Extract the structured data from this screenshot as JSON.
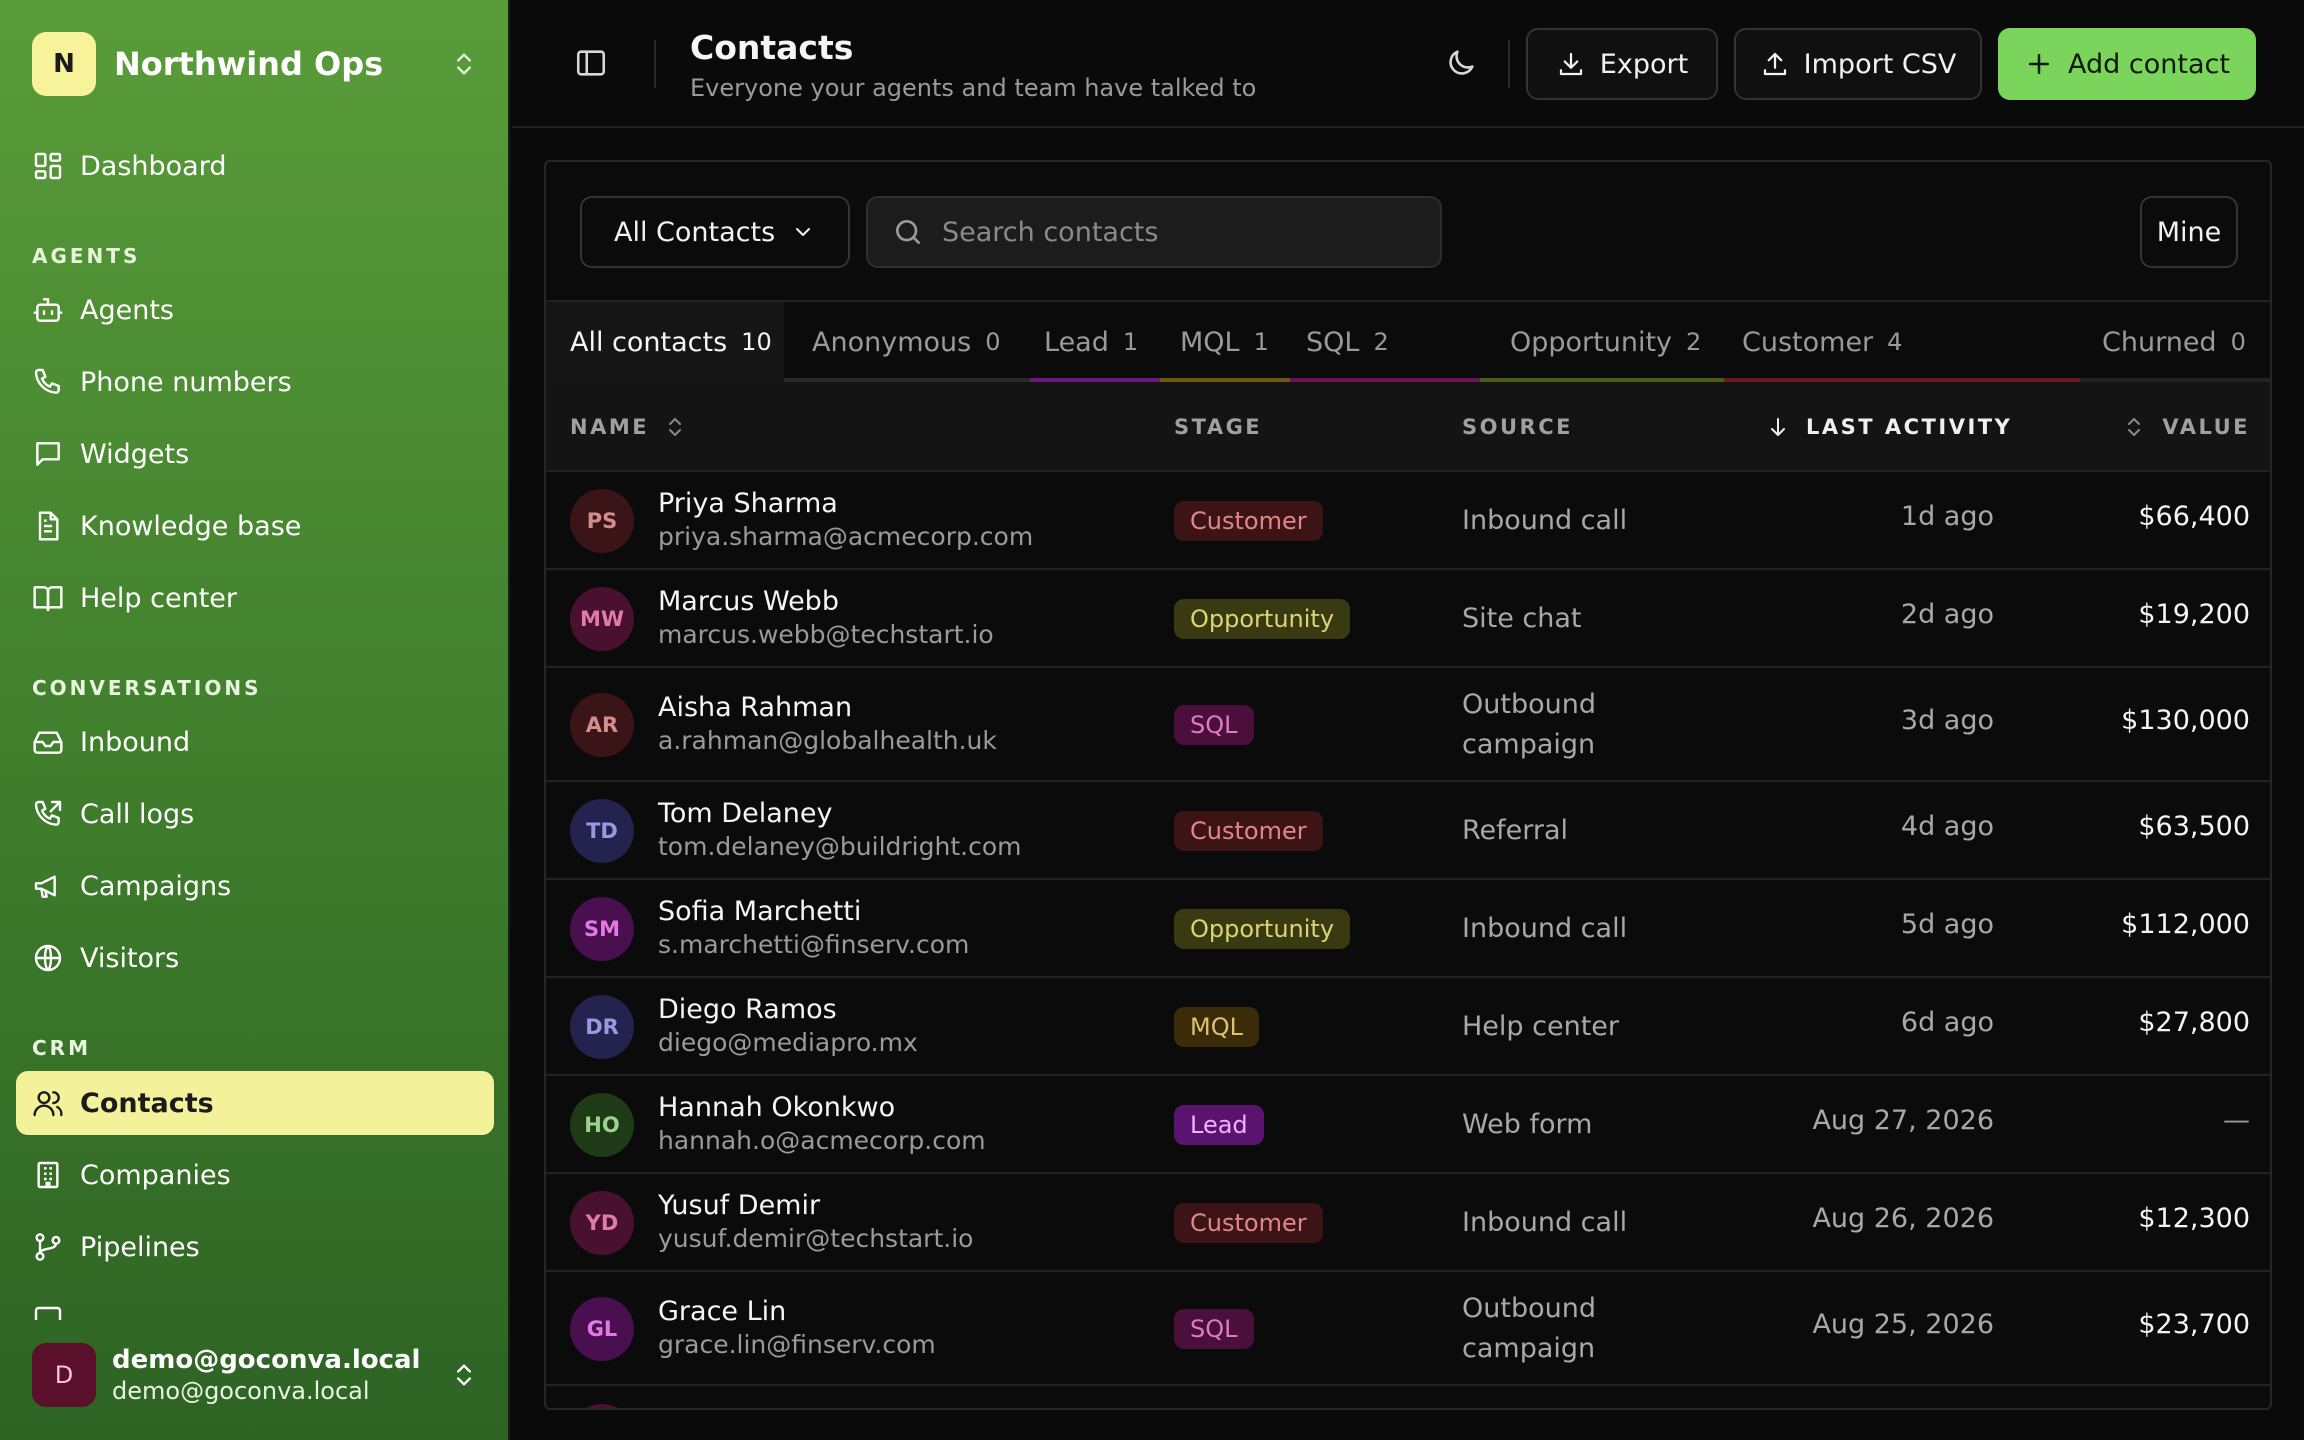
{
  "sidebar": {
    "org_initial": "N",
    "org_name": "Northwind Ops",
    "dashboard": "Dashboard",
    "section_agents": "AGENTS",
    "agents": "Agents",
    "phone_numbers": "Phone numbers",
    "widgets": "Widgets",
    "knowledge_base": "Knowledge base",
    "help_center": "Help center",
    "section_conversations": "CONVERSATIONS",
    "inbound": "Inbound",
    "call_logs": "Call logs",
    "campaigns": "Campaigns",
    "visitors": "Visitors",
    "section_crm": "CRM",
    "contacts": "Contacts",
    "companies": "Companies",
    "pipelines": "Pipelines",
    "user_initial": "D",
    "user_name": "demo@goconva.local",
    "user_email": "demo@goconva.local"
  },
  "header": {
    "title": "Contacts",
    "subtitle": "Everyone your agents and team have talked to",
    "export_label": "Export",
    "import_label": "Import CSV",
    "add_label": "Add contact"
  },
  "toolbar": {
    "filter_label": "All Contacts",
    "search_placeholder": "Search contacts",
    "mine_label": "Mine"
  },
  "tabs": [
    {
      "label": "All contacts",
      "count": "10"
    },
    {
      "label": "Anonymous",
      "count": "0"
    },
    {
      "label": "Lead",
      "count": "1"
    },
    {
      "label": "MQL",
      "count": "1"
    },
    {
      "label": "SQL",
      "count": "2"
    },
    {
      "label": "Opportunity",
      "count": "2"
    },
    {
      "label": "Customer",
      "count": "4"
    },
    {
      "label": "Churned",
      "count": "0"
    }
  ],
  "columns": {
    "name": "NAME",
    "stage": "STAGE",
    "source": "SOURCE",
    "last_activity": "LAST ACTIVITY",
    "value": "VALUE"
  },
  "rows": [
    {
      "initials": "PS",
      "name": "Priya Sharma",
      "email": "priya.sharma@acmecorp.com",
      "stage": "Customer",
      "source": "Inbound call",
      "activity": "1d ago",
      "value": "$66,400"
    },
    {
      "initials": "MW",
      "name": "Marcus Webb",
      "email": "marcus.webb@techstart.io",
      "stage": "Opportunity",
      "source": "Site chat",
      "activity": "2d ago",
      "value": "$19,200"
    },
    {
      "initials": "AR",
      "name": "Aisha Rahman",
      "email": "a.rahman@globalhealth.uk",
      "stage": "SQL",
      "source": "Outbound campaign",
      "activity": "3d ago",
      "value": "$130,000"
    },
    {
      "initials": "TD",
      "name": "Tom Delaney",
      "email": "tom.delaney@buildright.com",
      "stage": "Customer",
      "source": "Referral",
      "activity": "4d ago",
      "value": "$63,500"
    },
    {
      "initials": "SM",
      "name": "Sofia Marchetti",
      "email": "s.marchetti@finserv.com",
      "stage": "Opportunity",
      "source": "Inbound call",
      "activity": "5d ago",
      "value": "$112,000"
    },
    {
      "initials": "DR",
      "name": "Diego Ramos",
      "email": "diego@mediapro.mx",
      "stage": "MQL",
      "source": "Help center",
      "activity": "6d ago",
      "value": "$27,800"
    },
    {
      "initials": "HO",
      "name": "Hannah Okonkwo",
      "email": "hannah.o@acmecorp.com",
      "stage": "Lead",
      "source": "Web form",
      "activity": "Aug 27, 2026",
      "value": "—"
    },
    {
      "initials": "YD",
      "name": "Yusuf Demir",
      "email": "yusuf.demir@techstart.io",
      "stage": "Customer",
      "source": "Inbound call",
      "activity": "Aug 26, 2026",
      "value": "$12,300"
    },
    {
      "initials": "GL",
      "name": "Grace Lin",
      "email": "grace.lin@finserv.com",
      "stage": "SQL",
      "source": "Outbound campaign",
      "activity": "Aug 25, 2026",
      "value": "$23,700"
    }
  ],
  "colors": {
    "accent_green": "#7bd45c",
    "active_nav": "#f3f29a",
    "customer_badge_bg": "#3d1416",
    "opportunity_badge_bg": "#3a3a12",
    "sql_badge_bg": "#4a0f3a",
    "mql_badge_bg": "#3a2c08",
    "lead_badge_bg": "#5a1470"
  }
}
